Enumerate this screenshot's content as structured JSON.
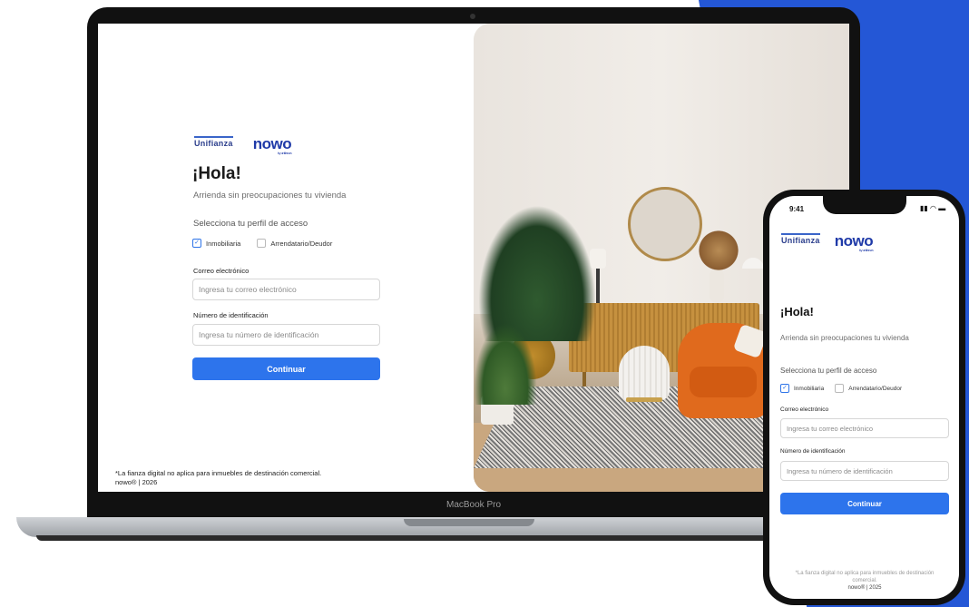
{
  "brand": {
    "unifianza": "Unifianza",
    "nowo": "nowo",
    "nowo_sub": "by unifianza"
  },
  "laptop": {
    "model": "MacBook Pro",
    "login": {
      "greeting": "¡Hola!",
      "subtitle": "Arrienda sin preocupaciones tu vivienda",
      "profile_prompt": "Selecciona tu perfil de acceso",
      "profiles": [
        {
          "label": "Inmobiliaria",
          "checked": true
        },
        {
          "label": "Arrendatario/Deudor",
          "checked": false
        }
      ],
      "email_label": "Correo electrónico",
      "email_placeholder": "Ingresa tu correo electrónico",
      "id_label": "Número de identificación",
      "id_placeholder": "Ingresa tu número de identificación",
      "submit": "Continuar",
      "footnote": "*La fianza digital no aplica para inmuebles de destinación comercial.",
      "copyright": "nowo® | 2026"
    }
  },
  "phone": {
    "time": "9:41",
    "status_icons": "signal wifi battery",
    "login": {
      "greeting": "¡Hola!",
      "subtitle": "Arrienda sin preocupaciones tu vivienda",
      "profile_prompt": "Selecciona tu perfil de acceso",
      "profiles": [
        {
          "label": "Inmobiliaria",
          "checked": true
        },
        {
          "label": "Arrendatario/Deudor",
          "checked": false
        }
      ],
      "email_label": "Correo electrónico",
      "email_placeholder": "Ingresa tu correo electrónico",
      "id_label": "Número de identificación",
      "id_placeholder": "Ingresa tu número de identificación",
      "submit": "Continuar",
      "footnote": "*La fianza digital no aplica para inmuebles de destinación comercial.",
      "copyright": "nowo® | 2025"
    }
  },
  "colors": {
    "accent": "#2d74ec",
    "brand_blue": "#2457d6",
    "nowo": "#1f3aa8"
  }
}
